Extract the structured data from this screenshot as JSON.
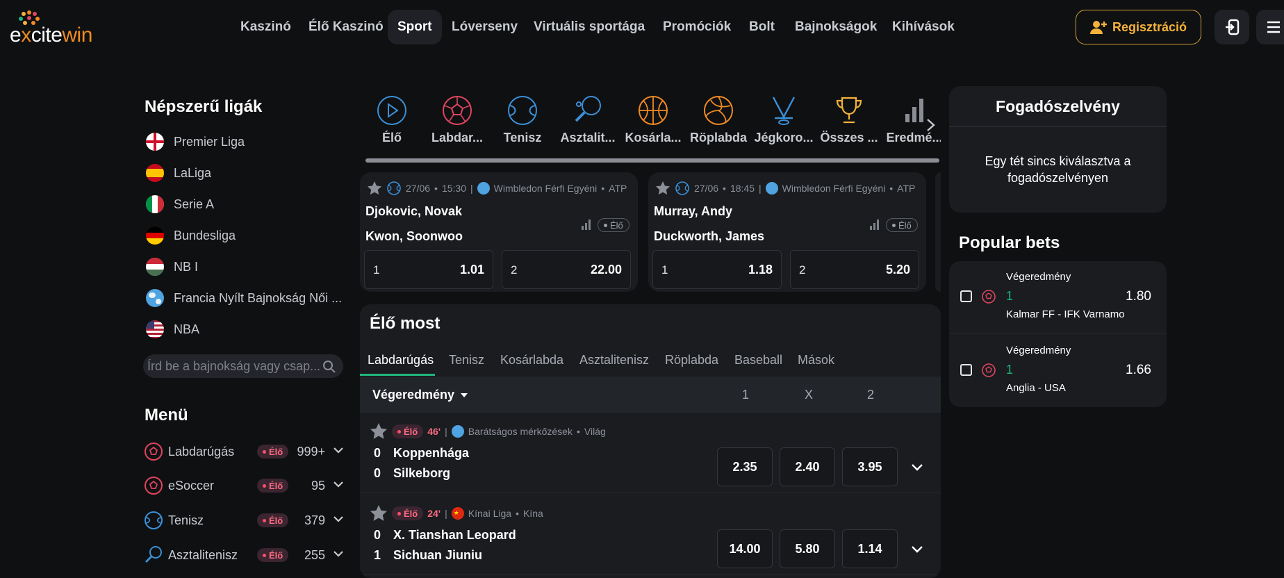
{
  "brand": {
    "logo_text_a": "e",
    "logo_text_b": "x",
    "logo_text_c": "cite",
    "logo_text_d": "win"
  },
  "nav": [
    "Kaszinó",
    "Élő Kaszinó",
    "Sport",
    "Lóverseny",
    "Virtuális sportága",
    "Promóciók",
    "Bolt",
    "Bajnokságok",
    "Kihívások"
  ],
  "header": {
    "register_label": "Regisztráció"
  },
  "sidebar": {
    "popular_title": "Népszerű ligák",
    "leagues": [
      {
        "label": "Premier Liga",
        "flag": "england"
      },
      {
        "label": "LaLiga",
        "flag": "spain"
      },
      {
        "label": "Serie A",
        "flag": "italy"
      },
      {
        "label": "Bundesliga",
        "flag": "germany"
      },
      {
        "label": "NB I",
        "flag": "hungary"
      },
      {
        "label": "Francia Nyílt Bajnokság Női ...",
        "flag": "world"
      },
      {
        "label": "NBA",
        "flag": "usa"
      }
    ],
    "search_placeholder": "Írd be a bajnokság vagy csap...",
    "menu_title": "Menü",
    "live_label": "Élő",
    "menu": [
      {
        "label": "Labdarúgás",
        "count": "999+",
        "icon": "football-icon"
      },
      {
        "label": "eSoccer",
        "count": "95",
        "icon": "esoccer-icon"
      },
      {
        "label": "Tenisz",
        "count": "379",
        "icon": "tennis-icon"
      },
      {
        "label": "Asztalitenisz",
        "count": "255",
        "icon": "table-tennis-icon"
      }
    ]
  },
  "sports": [
    {
      "label": "Élő",
      "icon": "play-icon",
      "color": "#3b8fd6"
    },
    {
      "label": "Labdar...",
      "icon": "football-icon",
      "color": "#e0455f"
    },
    {
      "label": "Tenisz",
      "icon": "tennis-icon",
      "color": "#3b8fd6"
    },
    {
      "label": "Asztalit...",
      "icon": "table-tennis-icon",
      "color": "#3b8fd6"
    },
    {
      "label": "Kosárla...",
      "icon": "basketball-icon",
      "color": "#f08a24"
    },
    {
      "label": "Röplabda",
      "icon": "volleyball-icon",
      "color": "#f08a24"
    },
    {
      "label": "Jégkoro...",
      "icon": "hockey-icon",
      "color": "#3b8fd6"
    },
    {
      "label": "Összes ...",
      "icon": "trophy-icon",
      "color": "#f3b23b"
    },
    {
      "label": "Eredmé...",
      "icon": "stats-icon",
      "color": "#8a8d94"
    }
  ],
  "featured": [
    {
      "date": "27/06",
      "time": "15:30",
      "competition": "Wimbledon Férfi Egyéni",
      "tour": "ATP",
      "team1": "Djokovic, Novak",
      "team2": "Kwon, Soonwoo",
      "live": "Élő",
      "odds": [
        {
          "k": "1",
          "v": "1.01"
        },
        {
          "k": "2",
          "v": "22.00"
        }
      ]
    },
    {
      "date": "27/06",
      "time": "18:45",
      "competition": "Wimbledon Férfi Egyéni",
      "tour": "ATP",
      "team1": "Murray, Andy",
      "team2": "Duckworth, James",
      "live": "Élő",
      "odds": [
        {
          "k": "1",
          "v": "1.18"
        },
        {
          "k": "2",
          "v": "5.20"
        }
      ]
    }
  ],
  "live_now": {
    "title": "Élő most",
    "tabs": [
      "Labdarúgás",
      "Tenisz",
      "Kosárlabda",
      "Asztalitenisz",
      "Röplabda",
      "Baseball",
      "Mások"
    ],
    "market": "Végeredmény",
    "cols": [
      "1",
      "X",
      "2"
    ],
    "live_label": "Élő",
    "matches": [
      {
        "minute": "46'",
        "league": "Barátságos mérkőzések",
        "region": "Világ",
        "flag": "world",
        "home": "Koppenhága",
        "away": "Silkeborg",
        "s1": "0",
        "s2": "0",
        "odds": [
          "2.35",
          "2.40",
          "3.95"
        ]
      },
      {
        "minute": "24'",
        "league": "Kínai Liga",
        "region": "Kína",
        "flag": "china",
        "home": "X. Tianshan Leopard",
        "away": "Sichuan Jiuniu",
        "s1": "0",
        "s2": "1",
        "odds": [
          "14.00",
          "5.80",
          "1.14"
        ]
      }
    ]
  },
  "betslip": {
    "title": "Fogadószelvény",
    "empty_text": "Egy tét sincs kiválasztva a fogadószelvényen"
  },
  "popular_bets": {
    "title": "Popular bets",
    "items": [
      {
        "market": "Végeredmény",
        "pick": "1",
        "odd": "1.80",
        "home": "Kalmar FF",
        "away": "IFK Varnamo"
      },
      {
        "market": "Végeredmény",
        "pick": "1",
        "odd": "1.66",
        "home": "Anglia",
        "away": "USA"
      }
    ],
    "sep": "-"
  },
  "colors": {
    "accent_green": "#1fb57a",
    "live_red": "#ff6b81",
    "register_gold": "#f3b23b"
  }
}
